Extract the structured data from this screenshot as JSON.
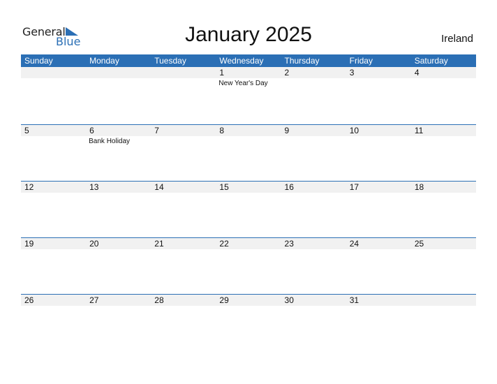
{
  "logo": {
    "general": "General",
    "blue": "Blue"
  },
  "title": "January 2025",
  "country": "Ireland",
  "colors": {
    "accent": "#2b6fb5",
    "strip": "#f1f1f1"
  },
  "weekdays": [
    "Sunday",
    "Monday",
    "Tuesday",
    "Wednesday",
    "Thursday",
    "Friday",
    "Saturday"
  ],
  "weeks": [
    [
      {
        "d": ""
      },
      {
        "d": ""
      },
      {
        "d": ""
      },
      {
        "d": "1",
        "h": "New Year's Day"
      },
      {
        "d": "2"
      },
      {
        "d": "3"
      },
      {
        "d": "4"
      }
    ],
    [
      {
        "d": "5"
      },
      {
        "d": "6",
        "h": "Bank Holiday"
      },
      {
        "d": "7"
      },
      {
        "d": "8"
      },
      {
        "d": "9"
      },
      {
        "d": "10"
      },
      {
        "d": "11"
      }
    ],
    [
      {
        "d": "12"
      },
      {
        "d": "13"
      },
      {
        "d": "14"
      },
      {
        "d": "15"
      },
      {
        "d": "16"
      },
      {
        "d": "17"
      },
      {
        "d": "18"
      }
    ],
    [
      {
        "d": "19"
      },
      {
        "d": "20"
      },
      {
        "d": "21"
      },
      {
        "d": "22"
      },
      {
        "d": "23"
      },
      {
        "d": "24"
      },
      {
        "d": "25"
      }
    ],
    [
      {
        "d": "26"
      },
      {
        "d": "27"
      },
      {
        "d": "28"
      },
      {
        "d": "29"
      },
      {
        "d": "30"
      },
      {
        "d": "31"
      },
      {
        "d": ""
      }
    ]
  ]
}
